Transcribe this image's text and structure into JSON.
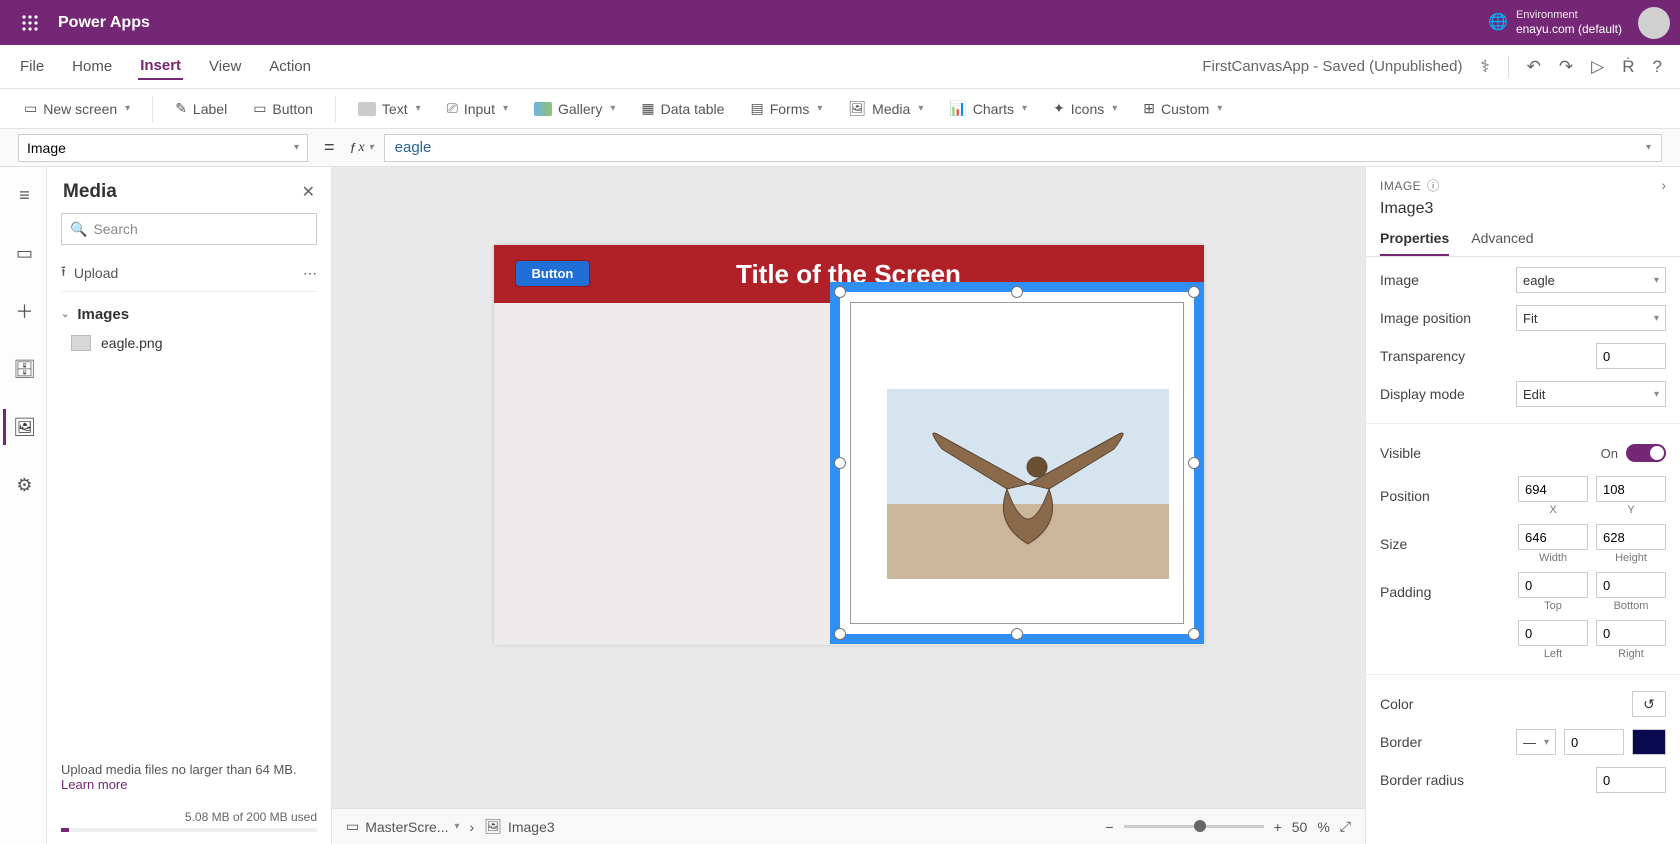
{
  "header": {
    "appName": "Power Apps",
    "envLabel": "Environment",
    "envValue": "enayu.com (default)"
  },
  "menu": {
    "items": [
      "File",
      "Home",
      "Insert",
      "View",
      "Action"
    ],
    "activeIndex": 2,
    "docStatus": "FirstCanvasApp - Saved (Unpublished)"
  },
  "ribbon": {
    "newScreen": "New screen",
    "label": "Label",
    "button": "Button",
    "text": "Text",
    "input": "Input",
    "gallery": "Gallery",
    "dataTable": "Data table",
    "forms": "Forms",
    "media": "Media",
    "charts": "Charts",
    "icons": "Icons",
    "custom": "Custom"
  },
  "formula": {
    "property": "Image",
    "value": "eagle"
  },
  "mediaPanel": {
    "title": "Media",
    "searchPlaceholder": "Search",
    "upload": "Upload",
    "sectionImages": "Images",
    "items": [
      "eagle.png"
    ],
    "footerLine": "Upload media files no larger than 64 MB.",
    "learnMore": "Learn more",
    "usage": "5.08 MB of 200 MB used"
  },
  "canvas": {
    "screenTitle": "Title of the Screen",
    "buttonLabel": "Button"
  },
  "status": {
    "crumb1": "MasterScre...",
    "crumb2": "Image3",
    "zoomPct": "50",
    "zoomUnit": "%"
  },
  "props": {
    "typeLabel": "IMAGE",
    "controlName": "Image3",
    "tabs": [
      "Properties",
      "Advanced"
    ],
    "activeTab": 0,
    "imageLabel": "Image",
    "imageValue": "eagle",
    "imagePosLabel": "Image position",
    "imagePosValue": "Fit",
    "transpLabel": "Transparency",
    "transpValue": "0",
    "dispModeLabel": "Display mode",
    "dispModeValue": "Edit",
    "visibleLabel": "Visible",
    "visibleOn": "On",
    "positionLabel": "Position",
    "posX": "694",
    "posXLbl": "X",
    "posY": "108",
    "posYLbl": "Y",
    "sizeLabel": "Size",
    "sizeW": "646",
    "sizeWLbl": "Width",
    "sizeH": "628",
    "sizeHLbl": "Height",
    "paddingLabel": "Padding",
    "padTop": "0",
    "padTopLbl": "Top",
    "padBottom": "0",
    "padBottomLbl": "Bottom",
    "padLeft": "0",
    "padLeftLbl": "Left",
    "padRight": "0",
    "padRightLbl": "Right",
    "colorLabel": "Color",
    "borderLabel": "Border",
    "borderVal": "0",
    "borderRadiusLabel": "Border radius",
    "borderRadiusVal": "0"
  }
}
